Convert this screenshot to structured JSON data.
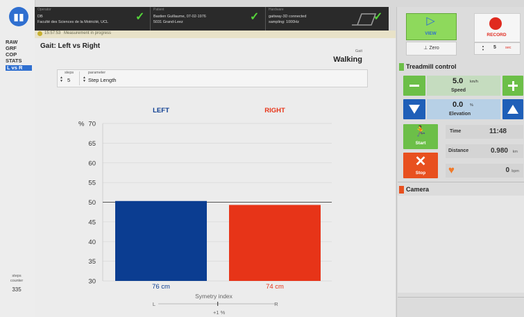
{
  "sidebar": {
    "logo_icon": "bar-chart-icon",
    "items": [
      {
        "label": "RAW",
        "active": false
      },
      {
        "label": "GRF",
        "active": false
      },
      {
        "label": "COP",
        "active": false
      },
      {
        "label": "STATS",
        "active": false
      },
      {
        "label": "L vs R",
        "active": true
      }
    ],
    "steps_counter": {
      "label_line1": "steps",
      "label_line2": "counter",
      "value": "335"
    }
  },
  "status_bar": {
    "operator": {
      "title": "Operator",
      "line1": "DB",
      "line2": "Faculté des Sciences de la Motricité, UCL"
    },
    "patient": {
      "title": "Patient",
      "line1": "Bastien Guillaume, 07-02-1976",
      "line2": "5031 Grand-Leez"
    },
    "hardware": {
      "title": "Hardware",
      "line1": "gaitway-3D connected",
      "line2": "sampling: 1000Hz"
    },
    "check_color": "#55d43a"
  },
  "measurement": {
    "time": "15:57:53",
    "status": "Measurement in progress"
  },
  "main": {
    "title": "Gait: Left vs Right",
    "gait_label": "Gait",
    "gait_value": "Walking",
    "param_bar": {
      "steps_label": "steps",
      "steps_value": "5",
      "parameter_label": "parameter",
      "parameter_value": "Step Length"
    }
  },
  "chart_data": {
    "type": "bar",
    "categories": [
      "LEFT",
      "RIGHT"
    ],
    "values": [
      50.3,
      49.3
    ],
    "value_labels": [
      "76 cm",
      "74 cm"
    ],
    "colors": [
      "#0b3d91",
      "#e73418"
    ],
    "ylabel": "%",
    "ylim": [
      30,
      70
    ],
    "yticks": [
      30,
      35,
      40,
      45,
      50,
      55,
      60,
      65,
      70
    ],
    "reference_line": 50,
    "grid": true,
    "symmetry": {
      "title": "Symetry index",
      "left": "L",
      "right": "R",
      "value": "+1 %",
      "position": 0.51
    }
  },
  "right": {
    "view_label": "VIEW",
    "view_icon": "play-icon",
    "zero_label": "Zero",
    "record_label": "RECORD",
    "record_time_value": "5",
    "record_time_unit": "sec",
    "treadmill_title": "Treadmill control",
    "speed_value": "5.0",
    "speed_unit": "km/h",
    "speed_label": "Speed",
    "elevation_value": "0.0",
    "elevation_unit": "%",
    "elevation_label": "Elevation",
    "start_label": "Start",
    "stop_label": "Stop",
    "time_label": "Time",
    "time_value": "11:48",
    "distance_label": "Distance",
    "distance_value": "0.980",
    "distance_unit": "km",
    "heart_value": "0",
    "heart_unit": "bpm",
    "camera_title": "Camera",
    "colors": {
      "green": "#6cbf48",
      "blue": "#1f5fb8",
      "red": "#e8501f",
      "orange": "#f07a2a"
    }
  }
}
